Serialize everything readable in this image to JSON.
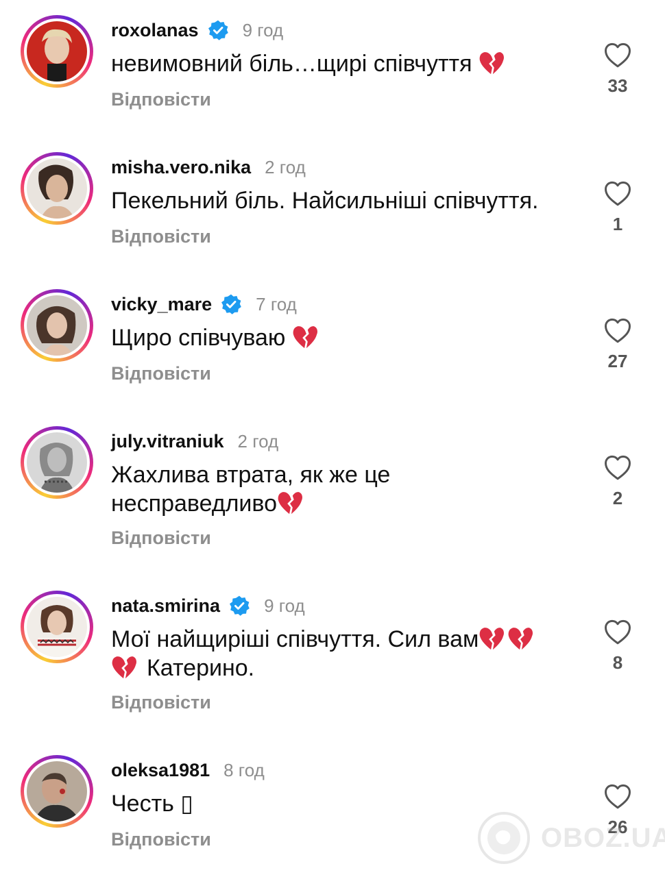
{
  "ui": {
    "reply_label": "Відповісти",
    "like_icon": "heart-outline-icon",
    "verified_icon": "verified-badge-icon",
    "emoji_icon": "broken-heart-emoji",
    "accent_verified": "#1d9bf0",
    "emoji_color": "#dd2e44"
  },
  "comments": [
    {
      "username": "roxolanas",
      "verified": true,
      "time": "9 год",
      "text": "невимовний біль…щирі співчуття",
      "likes": "33"
    },
    {
      "username": "misha.vero.nika",
      "verified": false,
      "time": "2 год",
      "text": "Пекельний біль. Найсильніші співчуття.",
      "likes": "1"
    },
    {
      "username": "vicky_mare",
      "verified": true,
      "time": "7 год",
      "text": "Щиро співчуваю",
      "likes": "27"
    },
    {
      "username": "july.vitraniuk",
      "verified": false,
      "time": "2 год",
      "text_line1": "Жахлива втрата, як же це",
      "text_line2": "несправедливо",
      "likes": "2"
    },
    {
      "username": "nata.smirina",
      "verified": true,
      "time": "9 год",
      "text_line1": "Мої найщиріші співчуття. Сил вам",
      "text_line2": "Катерино.",
      "likes": "8"
    },
    {
      "username": "oleksa1981",
      "verified": false,
      "time": "8 год",
      "text": "Честь ▯",
      "likes": "26"
    }
  ],
  "watermark": {
    "text": "OBOZ.UA"
  }
}
